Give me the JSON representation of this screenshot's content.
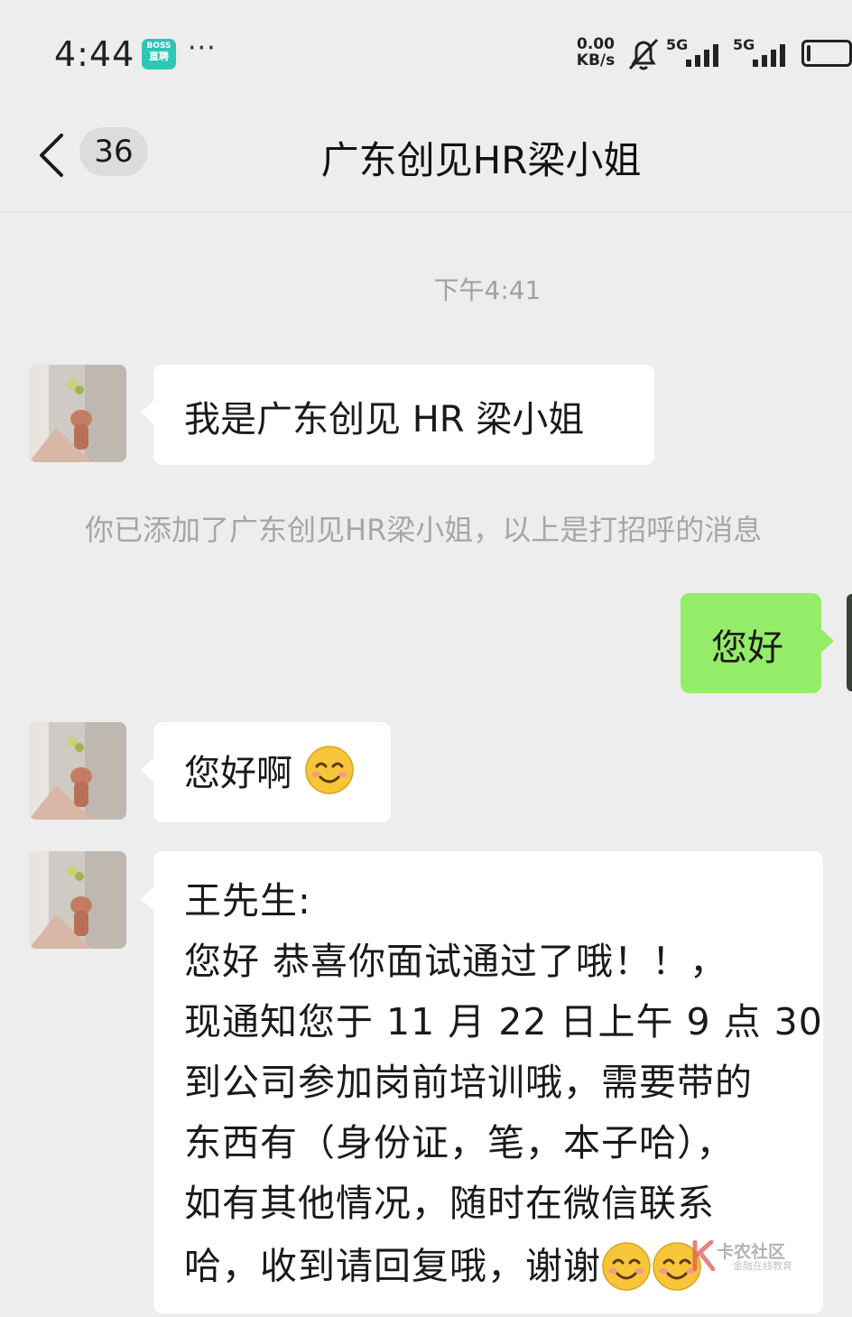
{
  "status_bar": {
    "time": "4:44",
    "app_badge_top": "BOSS",
    "app_badge_bottom": "直聘",
    "more": "···",
    "net_speed_value": "0.00",
    "net_speed_unit": "KB/s",
    "sim1": "5G",
    "sim2": "5G",
    "battery_level": 0.1
  },
  "header": {
    "unread_count": "36",
    "title": "广东创见HR梁小姐"
  },
  "chat": {
    "timestamp": "下午4:41",
    "messages": [
      {
        "text": "我是广东创见 HR 梁小姐"
      },
      {
        "text": "您好"
      },
      {
        "text": "您好啊"
      },
      {
        "lines": [
          "王先生:",
          "您好 恭喜你面试通过了哦！！，",
          "现通知您于 11 月 22 日上午 9 点 30",
          "到公司参加岗前培训哦，需要带的",
          "东西有（身份证，笔，本子哈），",
          "如有其他情况，随时在微信联系",
          "哈，收到请回复哦，谢谢"
        ]
      }
    ],
    "system_notice": "你已添加了广东创见HR梁小姐，以上是打招呼的消息"
  },
  "watermark": {
    "title": "卡农社区",
    "subtitle": "金融在线教育"
  },
  "colors": {
    "background": "#ededed",
    "sent_bubble": "#95ec69",
    "received_bubble": "#ffffff"
  }
}
